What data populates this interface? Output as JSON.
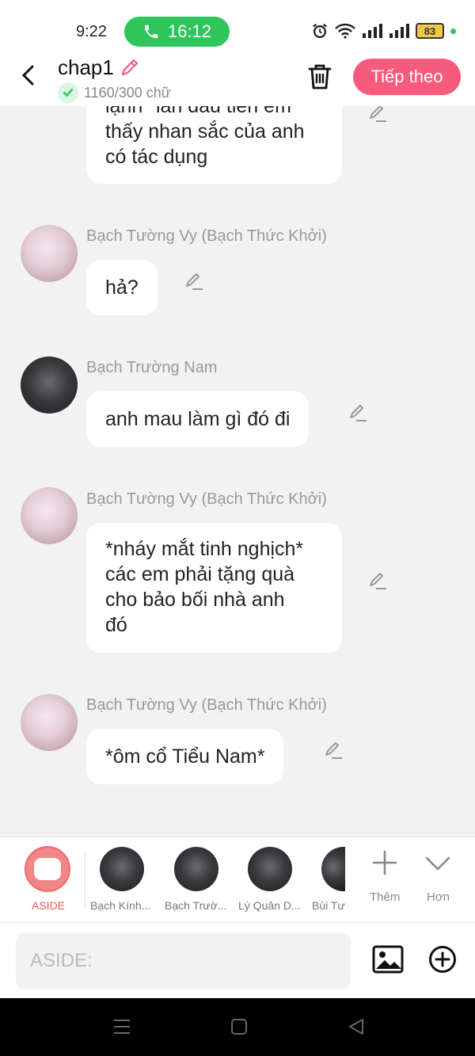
{
  "status_bar": {
    "time": "9:22",
    "call_timer": "16:12",
    "battery": "83"
  },
  "header": {
    "title": "chap1",
    "word_count": "1160/300 chữ",
    "next_button": "Tiếp theo"
  },
  "messages": [
    {
      "sender": "",
      "lines": [
        "lạnh* lần đầu tiên em",
        "thấy nhan sắc của anh",
        "có tác dụng"
      ]
    },
    {
      "sender": "Bạch Tường Vy (Bạch Thức Khởi)",
      "lines": [
        "hả?"
      ]
    },
    {
      "sender": "Bạch Trường Nam",
      "lines": [
        "anh mau làm gì đó đi"
      ]
    },
    {
      "sender": "Bạch Tường Vy (Bạch Thức Khởi)",
      "lines": [
        "*nháy mắt tinh nghịch*",
        "các em phải tặng quà",
        "cho bảo bối nhà anh",
        "đó"
      ]
    },
    {
      "sender": "Bạch Tường Vy (Bạch Thức Khởi)",
      "lines": [
        "*ôm cổ Tiểu Nam*"
      ]
    }
  ],
  "character_bar": {
    "aside_label": "ASIDE",
    "characters": [
      {
        "label": "Bạch Kính..."
      },
      {
        "label": "Bạch Trườ..."
      },
      {
        "label": "Lý Quân D..."
      },
      {
        "label": "Bùi Tư"
      }
    ],
    "add_label": "Thêm",
    "more_label": "Hơn"
  },
  "input": {
    "placeholder": "ASIDE:"
  },
  "colors": {
    "accent": "#f75a7a",
    "call_green": "#2ec55a",
    "aside_red": "#f05a5a"
  }
}
